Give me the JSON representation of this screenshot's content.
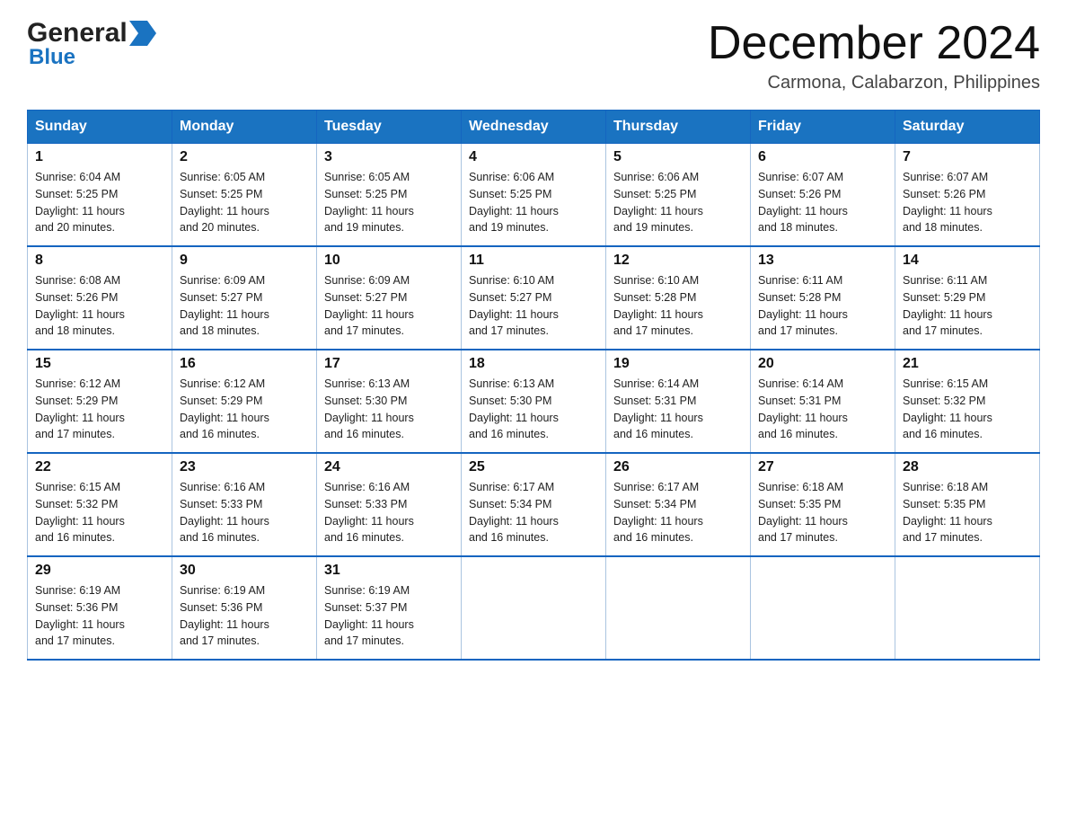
{
  "logo": {
    "general": "General",
    "blue": "Blue",
    "arrow": "▶"
  },
  "header": {
    "month_title": "December 2024",
    "location": "Carmona, Calabarzon, Philippines"
  },
  "days_of_week": [
    "Sunday",
    "Monday",
    "Tuesday",
    "Wednesday",
    "Thursday",
    "Friday",
    "Saturday"
  ],
  "weeks": [
    [
      {
        "day": "1",
        "sunrise": "6:04 AM",
        "sunset": "5:25 PM",
        "daylight": "11 hours and 20 minutes."
      },
      {
        "day": "2",
        "sunrise": "6:05 AM",
        "sunset": "5:25 PM",
        "daylight": "11 hours and 20 minutes."
      },
      {
        "day": "3",
        "sunrise": "6:05 AM",
        "sunset": "5:25 PM",
        "daylight": "11 hours and 19 minutes."
      },
      {
        "day": "4",
        "sunrise": "6:06 AM",
        "sunset": "5:25 PM",
        "daylight": "11 hours and 19 minutes."
      },
      {
        "day": "5",
        "sunrise": "6:06 AM",
        "sunset": "5:25 PM",
        "daylight": "11 hours and 19 minutes."
      },
      {
        "day": "6",
        "sunrise": "6:07 AM",
        "sunset": "5:26 PM",
        "daylight": "11 hours and 18 minutes."
      },
      {
        "day": "7",
        "sunrise": "6:07 AM",
        "sunset": "5:26 PM",
        "daylight": "11 hours and 18 minutes."
      }
    ],
    [
      {
        "day": "8",
        "sunrise": "6:08 AM",
        "sunset": "5:26 PM",
        "daylight": "11 hours and 18 minutes."
      },
      {
        "day": "9",
        "sunrise": "6:09 AM",
        "sunset": "5:27 PM",
        "daylight": "11 hours and 18 minutes."
      },
      {
        "day": "10",
        "sunrise": "6:09 AM",
        "sunset": "5:27 PM",
        "daylight": "11 hours and 17 minutes."
      },
      {
        "day": "11",
        "sunrise": "6:10 AM",
        "sunset": "5:27 PM",
        "daylight": "11 hours and 17 minutes."
      },
      {
        "day": "12",
        "sunrise": "6:10 AM",
        "sunset": "5:28 PM",
        "daylight": "11 hours and 17 minutes."
      },
      {
        "day": "13",
        "sunrise": "6:11 AM",
        "sunset": "5:28 PM",
        "daylight": "11 hours and 17 minutes."
      },
      {
        "day": "14",
        "sunrise": "6:11 AM",
        "sunset": "5:29 PM",
        "daylight": "11 hours and 17 minutes."
      }
    ],
    [
      {
        "day": "15",
        "sunrise": "6:12 AM",
        "sunset": "5:29 PM",
        "daylight": "11 hours and 17 minutes."
      },
      {
        "day": "16",
        "sunrise": "6:12 AM",
        "sunset": "5:29 PM",
        "daylight": "11 hours and 16 minutes."
      },
      {
        "day": "17",
        "sunrise": "6:13 AM",
        "sunset": "5:30 PM",
        "daylight": "11 hours and 16 minutes."
      },
      {
        "day": "18",
        "sunrise": "6:13 AM",
        "sunset": "5:30 PM",
        "daylight": "11 hours and 16 minutes."
      },
      {
        "day": "19",
        "sunrise": "6:14 AM",
        "sunset": "5:31 PM",
        "daylight": "11 hours and 16 minutes."
      },
      {
        "day": "20",
        "sunrise": "6:14 AM",
        "sunset": "5:31 PM",
        "daylight": "11 hours and 16 minutes."
      },
      {
        "day": "21",
        "sunrise": "6:15 AM",
        "sunset": "5:32 PM",
        "daylight": "11 hours and 16 minutes."
      }
    ],
    [
      {
        "day": "22",
        "sunrise": "6:15 AM",
        "sunset": "5:32 PM",
        "daylight": "11 hours and 16 minutes."
      },
      {
        "day": "23",
        "sunrise": "6:16 AM",
        "sunset": "5:33 PM",
        "daylight": "11 hours and 16 minutes."
      },
      {
        "day": "24",
        "sunrise": "6:16 AM",
        "sunset": "5:33 PM",
        "daylight": "11 hours and 16 minutes."
      },
      {
        "day": "25",
        "sunrise": "6:17 AM",
        "sunset": "5:34 PM",
        "daylight": "11 hours and 16 minutes."
      },
      {
        "day": "26",
        "sunrise": "6:17 AM",
        "sunset": "5:34 PM",
        "daylight": "11 hours and 16 minutes."
      },
      {
        "day": "27",
        "sunrise": "6:18 AM",
        "sunset": "5:35 PM",
        "daylight": "11 hours and 17 minutes."
      },
      {
        "day": "28",
        "sunrise": "6:18 AM",
        "sunset": "5:35 PM",
        "daylight": "11 hours and 17 minutes."
      }
    ],
    [
      {
        "day": "29",
        "sunrise": "6:19 AM",
        "sunset": "5:36 PM",
        "daylight": "11 hours and 17 minutes."
      },
      {
        "day": "30",
        "sunrise": "6:19 AM",
        "sunset": "5:36 PM",
        "daylight": "11 hours and 17 minutes."
      },
      {
        "day": "31",
        "sunrise": "6:19 AM",
        "sunset": "5:37 PM",
        "daylight": "11 hours and 17 minutes."
      },
      null,
      null,
      null,
      null
    ]
  ],
  "labels": {
    "sunrise": "Sunrise:",
    "sunset": "Sunset:",
    "daylight": "Daylight:"
  }
}
